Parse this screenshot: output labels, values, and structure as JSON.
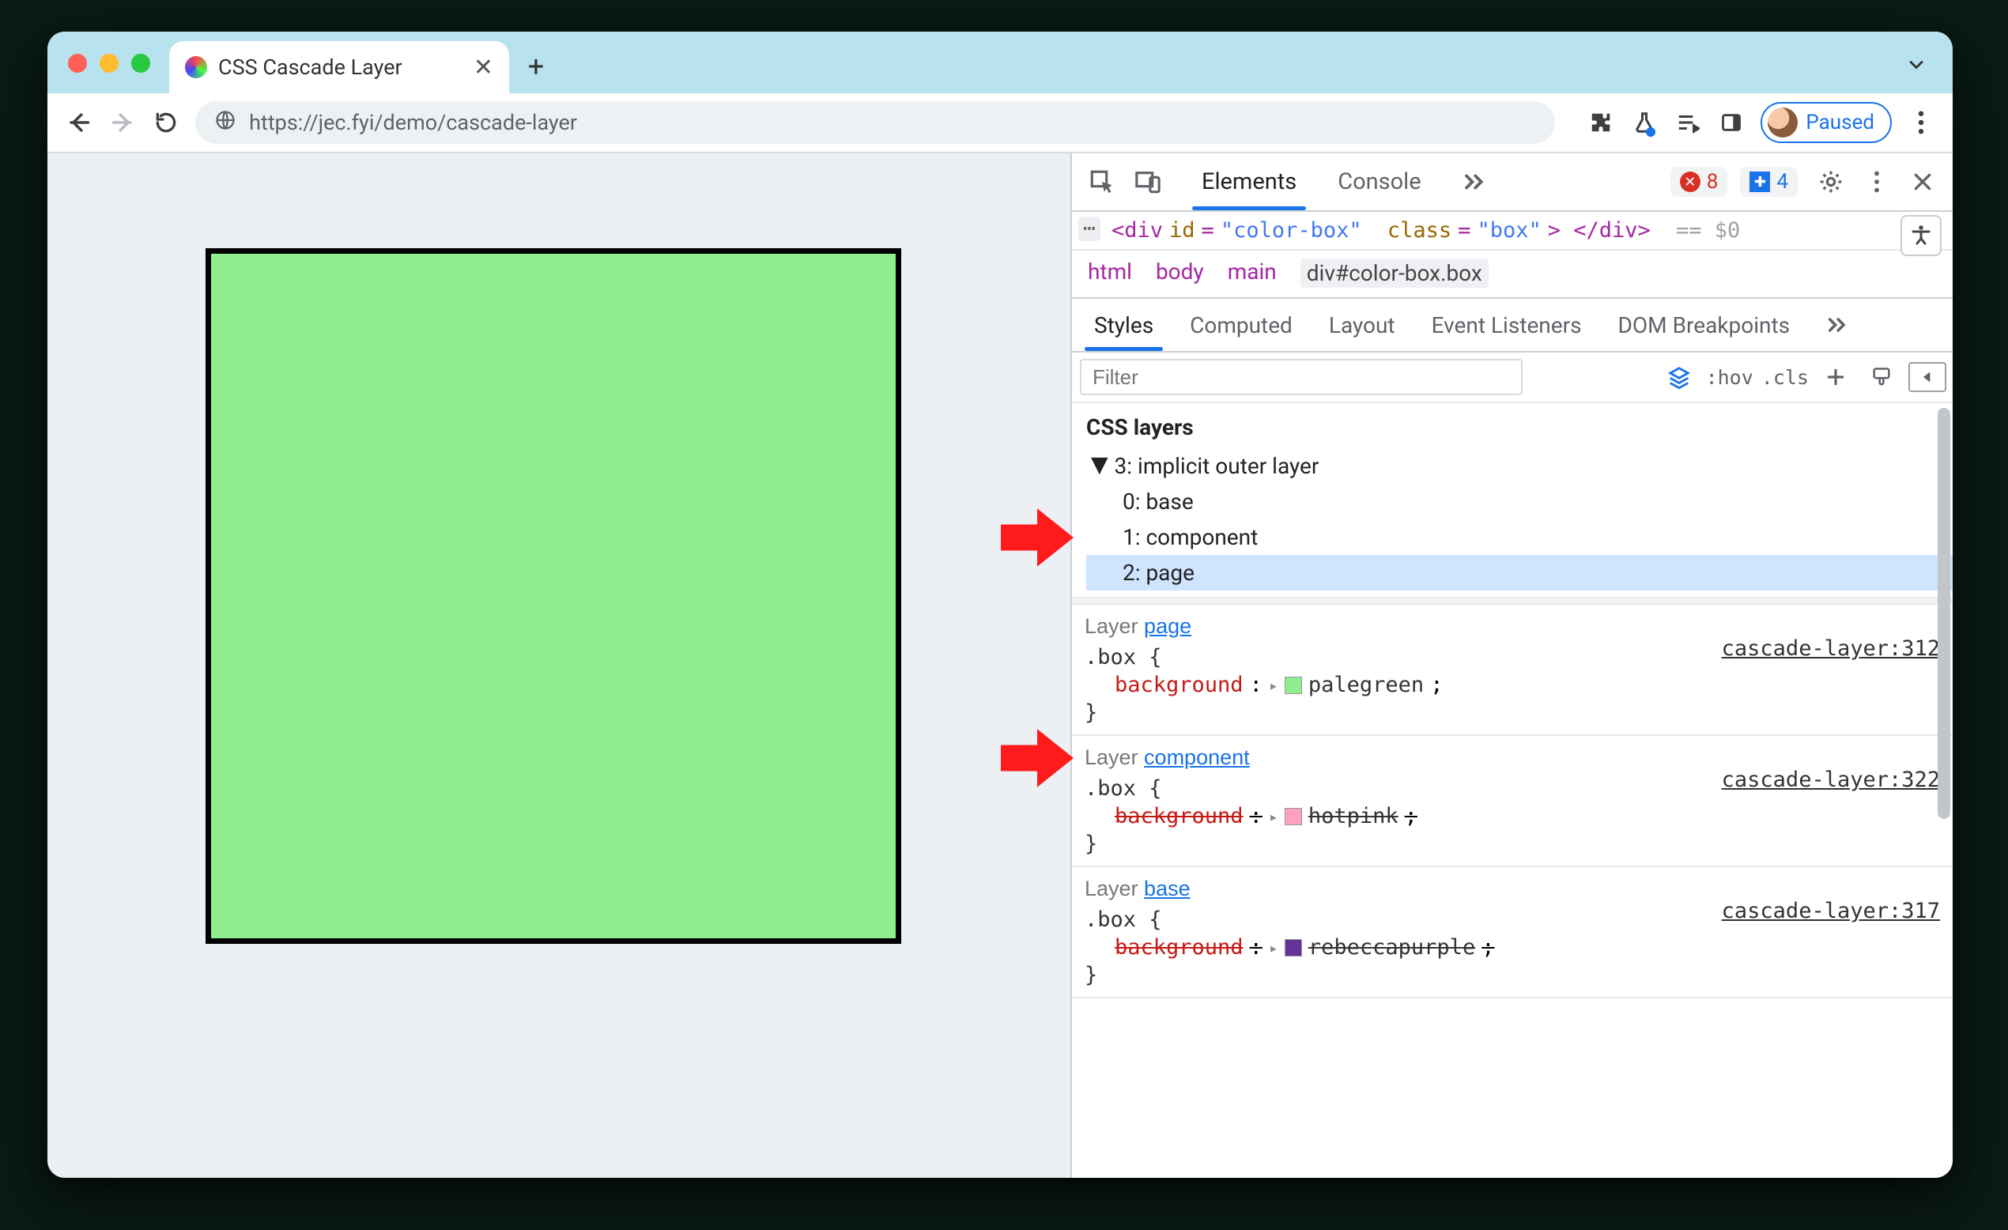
{
  "tab": {
    "title": "CSS Cascade Layer"
  },
  "url": "https://jec.fyi/demo/cascade-layer",
  "paused_label": "Paused",
  "devtools": {
    "tabs": {
      "elements": "Elements",
      "console": "Console"
    },
    "errors": "8",
    "issues": "4",
    "dom_line": {
      "prefix": "<div ",
      "id_attr": "id",
      "id_val": "\"color-box\"",
      "class_attr": "class",
      "class_val": "\"box\"",
      "suffix1": "> </div>",
      "eq": "== $0"
    },
    "crumbs": [
      "html",
      "body",
      "main"
    ],
    "crumb_selected": "div#color-box.box",
    "subtabs": {
      "styles": "Styles",
      "computed": "Computed",
      "layout": "Layout",
      "listeners": "Event Listeners",
      "dom_bp": "DOM Breakpoints"
    },
    "filter_placeholder": "Filter",
    "hov": ":hov",
    "cls": ".cls",
    "css_layers_title": "CSS layers",
    "tree": {
      "root": "3: implicit outer layer",
      "items": [
        "0: base",
        "1: component",
        "2: page"
      ],
      "selected_index": 2
    },
    "rules": [
      {
        "layer_label": "Layer ",
        "layer_link": "page",
        "selector": ".box {",
        "close": "}",
        "prop": "background",
        "value": "palegreen",
        "swatch": "#90ee90",
        "source": "cascade-layer:312",
        "overridden": false
      },
      {
        "layer_label": "Layer ",
        "layer_link": "component",
        "selector": ".box {",
        "close": "}",
        "prop": "background",
        "value": "hotpink",
        "swatch": "#ff9fc3",
        "source": "cascade-layer:322",
        "overridden": true
      },
      {
        "layer_label": "Layer ",
        "layer_link": "base",
        "selector": ".box {",
        "close": "}",
        "prop": "background",
        "value": "rebeccapurple",
        "swatch": "#663399",
        "source": "cascade-layer:317",
        "overridden": true
      }
    ]
  }
}
